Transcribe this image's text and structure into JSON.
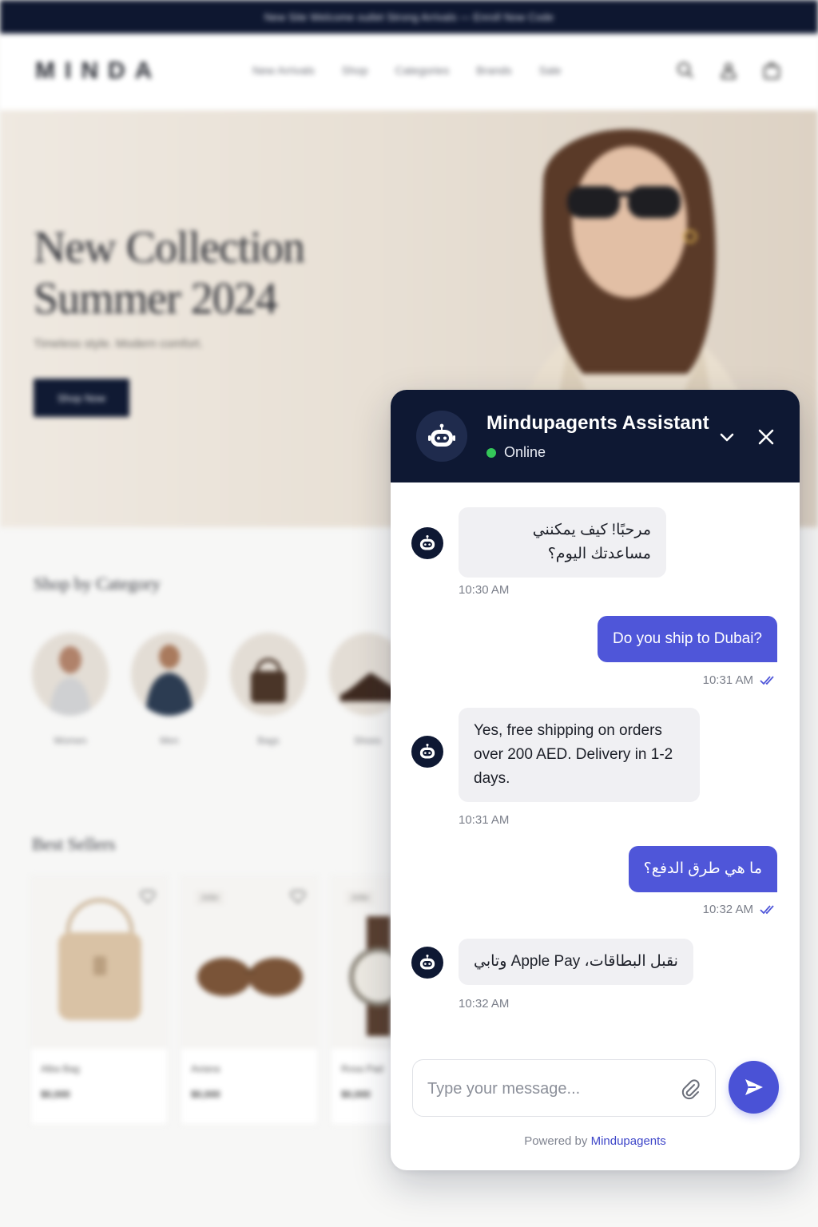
{
  "store": {
    "announcement": "New Site Welcome outlet Strong Arrivals — Enroll Now Code",
    "logo": "MINDA",
    "nav": [
      "New Arrivals",
      "Shop",
      "Categories",
      "Brands",
      "Sale"
    ],
    "hero": {
      "title_line1": "New Collection",
      "title_line2": "Summer 2024",
      "subtitle": "Timeless style. Modern comfort.",
      "cta": "Shop Now"
    },
    "categories_title": "Shop by Category",
    "categories": [
      "Women",
      "Men",
      "Bags",
      "Shoes"
    ],
    "bestsellers_title": "Best Sellers",
    "products": [
      {
        "name": "Alba Bag",
        "price": "$0,000",
        "tag": ""
      },
      {
        "name": "Aviana",
        "price": "$0,000",
        "tag": "Jolie"
      },
      {
        "name": "Rosa Pad",
        "price": "$0,000",
        "tag": "Jolie"
      }
    ]
  },
  "chat": {
    "title": "Mindupagents Assistant",
    "status": "Online",
    "status_color": "#34c759",
    "accent_color": "#4f56d9",
    "header_color": "#0e1833",
    "messages": [
      {
        "sender": "bot",
        "text": "مرحبًا! كيف يمكنني مساعدتك اليوم؟",
        "time": "10:30 AM"
      },
      {
        "sender": "user",
        "text": "Do you ship to Dubai?",
        "time": "10:31 AM",
        "read": true
      },
      {
        "sender": "bot",
        "text": "Yes, free shipping on orders over 200 AED. Delivery in 1-2 days.",
        "time": "10:31 AM"
      },
      {
        "sender": "user",
        "text": "ما هي طرق الدفع؟",
        "time": "10:32 AM",
        "read": true
      },
      {
        "sender": "bot",
        "text": "نقبل البطاقات، Apple Pay وتابي",
        "time": "10:32 AM"
      }
    ],
    "input_placeholder": "Type your message...",
    "powered_prefix": "Powered by",
    "powered_brand": "Mindupagents",
    "icons": {
      "avatar": "robot-icon",
      "minimize": "chevron-down-icon",
      "close": "close-icon",
      "read_receipt": "double-check-icon",
      "attach": "paperclip-icon",
      "send": "send-icon"
    }
  }
}
